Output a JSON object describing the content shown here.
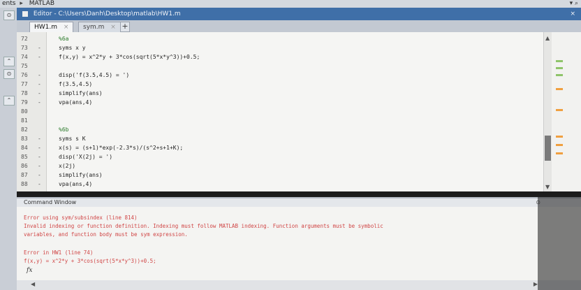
{
  "pathbar": {
    "segment1": "ents",
    "separator": "▸",
    "segment2": "MATLAB"
  },
  "editor": {
    "title": "Editor - C:\\Users\\Danh\\Desktop\\matlab\\HW1.m",
    "close_label": "×",
    "tabs": [
      {
        "label": "HW1.m",
        "close": "×",
        "active": true
      },
      {
        "label": "sym.m",
        "close": "×",
        "active": false
      }
    ],
    "add_tab_label": "+"
  },
  "code_lines": [
    {
      "num": "72",
      "exec": "",
      "text": "%6a",
      "comment": true
    },
    {
      "num": "73",
      "exec": "-",
      "text": "syms x y",
      "comment": false
    },
    {
      "num": "74",
      "exec": "-",
      "text": "f(x,y) = x^2*y + 3*cos(sqrt(5*x*y^3))+0.5;",
      "comment": false
    },
    {
      "num": "75",
      "exec": "",
      "text": "",
      "comment": false
    },
    {
      "num": "76",
      "exec": "-",
      "text": "disp('f(3.5,4.5) = ')",
      "comment": false
    },
    {
      "num": "77",
      "exec": "-",
      "text": "f(3.5,4.5)",
      "comment": false
    },
    {
      "num": "78",
      "exec": "-",
      "text": "simplify(ans)",
      "comment": false
    },
    {
      "num": "79",
      "exec": "-",
      "text": "vpa(ans,4)",
      "comment": false
    },
    {
      "num": "80",
      "exec": "",
      "text": "",
      "comment": false
    },
    {
      "num": "81",
      "exec": "",
      "text": "",
      "comment": false
    },
    {
      "num": "82",
      "exec": "",
      "text": "%6b",
      "comment": true
    },
    {
      "num": "83",
      "exec": "-",
      "text": "syms s K",
      "comment": false
    },
    {
      "num": "84",
      "exec": "-",
      "text": "x(s) = (s+1)*exp(-2.3*s)/(s^2+s+1+K);",
      "comment": false
    },
    {
      "num": "85",
      "exec": "-",
      "text": "disp('X(2j) = ')",
      "comment": false
    },
    {
      "num": "86",
      "exec": "-",
      "text": "x(2j)",
      "comment": false
    },
    {
      "num": "87",
      "exec": "-",
      "text": "simplify(ans)",
      "comment": false
    },
    {
      "num": "88",
      "exec": "-",
      "text": "vpa(ans,4)",
      "comment": false
    }
  ],
  "command_window": {
    "title": "Command Window",
    "lines": [
      "Error using sym/subsindex (line 814)",
      "Invalid indexing or function definition. Indexing must follow MATLAB indexing. Function arguments must be symbolic",
      "variables, and function body must be sym expression.",
      "",
      "Error in HW1 (line 74)",
      "f(x,y) = x^2*y + 3*cos(sqrt(5*x*y^3))+0.5;"
    ],
    "prompt": "fx"
  },
  "colors": {
    "title_bar": "#3f6fa8",
    "error_text": "#d04545",
    "comment": "#2a7a2a",
    "marker_warning": "#f0a040",
    "marker_ok": "#8fc46a"
  }
}
